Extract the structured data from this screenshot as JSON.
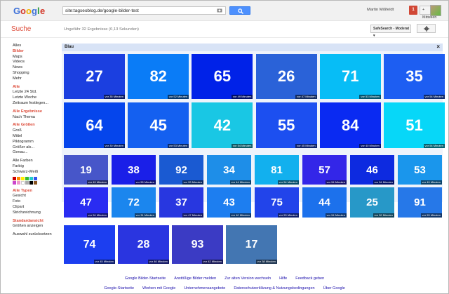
{
  "header": {
    "search_value": "site:tagseoblog.de/google-bilder-test",
    "user_name": "Martin Mißfeldt",
    "notification_count": "1",
    "share_label": "+ Mitteilen"
  },
  "subheader": {
    "title": "Suche",
    "result_count": "Ungefähr 32 Ergebnisse (0,13 Sekunden)",
    "safesearch_label": "SafeSearch - Moderat ▾"
  },
  "sidebar": {
    "types": [
      "Alles",
      "Bilder",
      "Maps",
      "Videos",
      "News",
      "Shopping",
      "Mehr"
    ],
    "time_head": "Alle",
    "time_items": [
      "Letzte 24 Std.",
      "Letzte Woche",
      "Zeitraum festlegen..."
    ],
    "results_head": "Alle Ergebnisse",
    "results_items": [
      "Nach Thema"
    ],
    "size_head": "Alle Größen",
    "size_items": [
      "Groß",
      "Mittel",
      "Piktogramm",
      "Größer als...",
      "Genau..."
    ],
    "color_items": [
      "Alle Farben",
      "Farbig",
      "Schwarz-Weiß"
    ],
    "swatch_colors": [
      "#cc0000",
      "#ff8800",
      "#ffee00",
      "#33bb33",
      "#22cccc",
      "#3355ee",
      "#cc44cc",
      "#ee99cc",
      "#ffffff",
      "#aaaaaa",
      "#000000",
      "#885522"
    ],
    "types_head": "Alle Typen",
    "type_items": [
      "Gesicht",
      "Foto",
      "Clipart",
      "Strichzeichnung"
    ],
    "view_head": "Standardansicht",
    "view_items": [
      "Größen anzeigen"
    ],
    "reset": "Auswahl zurücksetzen"
  },
  "filter_bar": {
    "label": "Blau",
    "close": "×"
  },
  "rows": [
    [
      {
        "n": "27",
        "c": "#1b3fe0",
        "t": "vor 35 Minuten"
      },
      {
        "n": "82",
        "c": "#0a7cf7",
        "t": "vor 52 Minuten"
      },
      {
        "n": "65",
        "c": "#0022e8",
        "t": "vor 49 Minuten"
      },
      {
        "n": "26",
        "c": "#2a62d8",
        "t": "vor 47 Minuten"
      },
      {
        "n": "71",
        "c": "#07bdf6",
        "t": "vor 53 Minuten"
      },
      {
        "n": "35",
        "c": "#1d5ef2",
        "t": "vor 54 Minuten"
      }
    ],
    [
      {
        "n": "64",
        "c": "#0545ec",
        "t": "vor 30 Minuten"
      },
      {
        "n": "45",
        "c": "#1460f0",
        "t": "vor 53 Minuten"
      },
      {
        "n": "42",
        "c": "#19c7e4",
        "t": "vor 54 Minuten"
      },
      {
        "n": "55",
        "c": "#1c4ff0",
        "t": "vor 45 Minuten"
      },
      {
        "n": "84",
        "c": "#0a2af2",
        "t": "vor 40 Minuten"
      },
      {
        "n": "51",
        "c": "#07d7f8",
        "t": "vor 54 Minuten"
      }
    ],
    [
      {
        "n": "19",
        "c": "#4756c9",
        "t": "vor 49 Minuten"
      },
      {
        "n": "38",
        "c": "#1a1fe8",
        "t": "vor 55 Minuten"
      },
      {
        "n": "92",
        "c": "#1a5ad2",
        "t": "vor 53 Minuten"
      },
      {
        "n": "34",
        "c": "#1e8ee8",
        "t": "vor 44 Minuten"
      },
      {
        "n": "81",
        "c": "#12b0ee",
        "t": "vor 54 Minuten"
      },
      {
        "n": "57",
        "c": "#3326e8",
        "t": "vor 54 Minuten"
      },
      {
        "n": "46",
        "c": "#0d2ae0",
        "t": "vor 54 Minuten"
      },
      {
        "n": "53",
        "c": "#1a96ec",
        "t": "vor 49 Minuten"
      }
    ],
    [
      {
        "n": "47",
        "c": "#2a2cf2",
        "t": "vor 54 Minuten"
      },
      {
        "n": "72",
        "c": "#1b86ee",
        "t": "vor 31 Minuten"
      },
      {
        "n": "37",
        "c": "#2837e0",
        "t": "vor 47 Minuten"
      },
      {
        "n": "43",
        "c": "#1d7ef0",
        "t": "vor 40 Minuten"
      },
      {
        "n": "75",
        "c": "#2244ea",
        "t": "vor 53 Minuten"
      },
      {
        "n": "44",
        "c": "#1c71ec",
        "t": "vor 54 Minuten"
      },
      {
        "n": "25",
        "c": "#2798c8",
        "t": "vor 52 Minuten"
      },
      {
        "n": "91",
        "c": "#2678e8",
        "t": "vor 53 Minuten"
      }
    ],
    [
      {
        "n": "74",
        "c": "#1c3ef0",
        "t": "vor 45 Minuten"
      },
      {
        "n": "28",
        "c": "#2a35e0",
        "t": "vor 46 Minuten"
      },
      {
        "n": "93",
        "c": "#3b3bc4",
        "t": "vor 42 Minuten"
      },
      {
        "n": "17",
        "c": "#4376b2",
        "t": "vor 38 Minuten"
      }
    ]
  ],
  "footer": {
    "row1": [
      "Google Bilder-Startseite",
      "Anstößige Bilder melden",
      "Zur alten Version wechseln",
      "Hilfe",
      "Feedback geben"
    ],
    "row2": [
      "Google-Startseite",
      "Werben mit Google",
      "Unternehmensangebote",
      "Datenschutzerklärung & Nutzungsbedingungen",
      "Über Google"
    ]
  }
}
